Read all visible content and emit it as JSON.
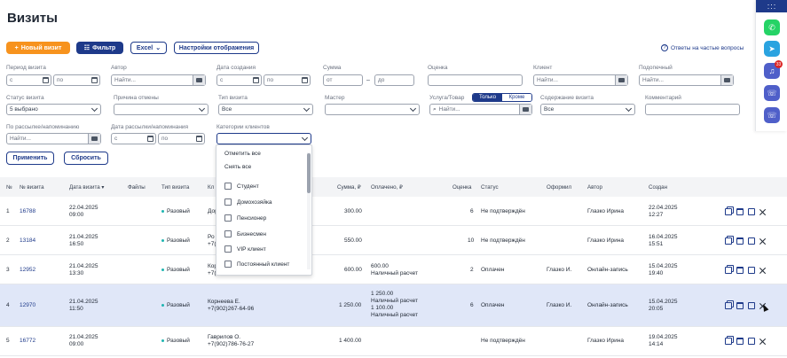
{
  "page": {
    "title": "Визиты"
  },
  "toolbar": {
    "new_visit": "Новый визит",
    "filter": "Фильтр",
    "excel": "Excel",
    "display_settings": "Настройки отображения",
    "faq": "Ответы на частые вопросы"
  },
  "filters": {
    "visit_period": {
      "label": "Период визита",
      "from": "с",
      "to": "по"
    },
    "author": {
      "label": "Автор",
      "placeholder": "Найти..."
    },
    "created_date": {
      "label": "Дата создания",
      "from": "с",
      "to": "по"
    },
    "sum": {
      "label": "Сумма",
      "from": "от",
      "to": "до",
      "dash": "–"
    },
    "rating": {
      "label": "Оценка"
    },
    "client": {
      "label": "Клиент",
      "placeholder": "Найти..."
    },
    "recommender": {
      "label": "Подопечный",
      "placeholder": "Найти..."
    },
    "visit_status": {
      "label": "Статус визита",
      "value": "5 выбрано"
    },
    "cancel_reason": {
      "label": "Причина отмены",
      "value": ""
    },
    "visit_type": {
      "label": "Тип визита",
      "value": "Все"
    },
    "master": {
      "label": "Мастер",
      "value": ""
    },
    "service": {
      "label": "Услуга/Товар",
      "placeholder": "Найти...",
      "toggle_on": "Только",
      "toggle_off": "Кроме"
    },
    "visit_content": {
      "label": "Содержание визита",
      "value": "Все"
    },
    "comment": {
      "label": "Комментарий"
    },
    "by_mailing": {
      "label": "По рассылке/напоминанию",
      "placeholder": "Найти..."
    },
    "mailing_date": {
      "label": "Дата рассылки/напоминания",
      "from": "с",
      "to": "по"
    },
    "client_category": {
      "label": "Категории клиентов",
      "value": ""
    },
    "apply": "Применить",
    "reset": "Сбросить"
  },
  "dropdown": {
    "select_all": "Отметить все",
    "clear_all": "Снять все",
    "options": [
      "Студент",
      "Домохозяйка",
      "Пенсионер",
      "Бизнесмен",
      "VIP клиент",
      "Постоянный клиент"
    ]
  },
  "table": {
    "headers": {
      "num": "№",
      "visit_no": "№ визита",
      "visit_date": "Дата визита ▾",
      "files": "Файлы",
      "type": "Тип визита",
      "client": "Кл",
      "sum": "Сумма, ₽",
      "paid": "Оплачено, ₽",
      "rating": "Оценка",
      "status": "Статус",
      "cashier": "Оформил",
      "author": "Автор",
      "created": "Создан"
    },
    "rows": [
      {
        "num": "1",
        "visit_no": "16788",
        "date": "22.04.2025",
        "time": "09:00",
        "type": "Разовый",
        "client": "Дор",
        "phone": "",
        "sum": "300.00",
        "paid": "",
        "paid2": "",
        "paid3": "",
        "paid4": "",
        "rating": "6",
        "status": "Не подтверждён",
        "cashier": "",
        "author": "Глазко Ирина",
        "created_date": "22.04.2025",
        "created_time": "12:27"
      },
      {
        "num": "2",
        "visit_no": "13184",
        "date": "21.04.2025",
        "time": "16:50",
        "type": "Разовый",
        "client": "Ро",
        "phone": "+7(",
        "sum": "550.00",
        "paid": "",
        "paid2": "",
        "paid3": "",
        "paid4": "",
        "rating": "10",
        "status": "Не подтверждён",
        "cashier": "",
        "author": "Глазко Ирина",
        "created_date": "16.04.2025",
        "created_time": "15:51"
      },
      {
        "num": "3",
        "visit_no": "12952",
        "date": "21.04.2025",
        "time": "13:30",
        "type": "Разовый",
        "client": "Кор",
        "phone": "+7(",
        "sum": "600.00",
        "paid": "600.00",
        "paid2": "Наличный расчет",
        "paid3": "",
        "paid4": "",
        "rating": "2",
        "status": "Оплачен",
        "cashier": "Глазко И.",
        "author": "Онлайн-запись",
        "created_date": "15.04.2025",
        "created_time": "19:40"
      },
      {
        "num": "4",
        "visit_no": "12970",
        "date": "21.04.2025",
        "time": "11:50",
        "type": "Разовый",
        "client": "Корнеева Е.",
        "phone": "+7(902)267-64-96",
        "sum": "1 250.00",
        "paid": "1 250.00",
        "paid2": "Наличный расчет",
        "paid3": "1 100.00",
        "paid4": "Наличный расчет",
        "rating": "6",
        "status": "Оплачен",
        "cashier": "Глазко И.",
        "author": "Онлайн-запись",
        "created_date": "15.04.2025",
        "created_time": "20:05"
      },
      {
        "num": "5",
        "visit_no": "16772",
        "date": "21.04.2025",
        "time": "09:00",
        "type": "Разовый",
        "client": "Гаврилов О.",
        "phone": "+7(902)786-76-27",
        "sum": "1 400.00",
        "paid": "",
        "paid2": "",
        "paid3": "",
        "paid4": "",
        "rating": "",
        "status": "Не подтверждён",
        "cashier": "",
        "author": "Глазко Ирина",
        "created_date": "19.04.2025",
        "created_time": "14:14"
      }
    ]
  },
  "rail": {
    "menu": ":::",
    "badge": "33"
  },
  "colors": {
    "brand": "#1e3a8a",
    "accent": "#f7931e",
    "highlight": "#e0e7f8",
    "whatsapp": "#25d366",
    "telegram": "#2aa3e0",
    "rail_button": "#4f5fc9"
  }
}
